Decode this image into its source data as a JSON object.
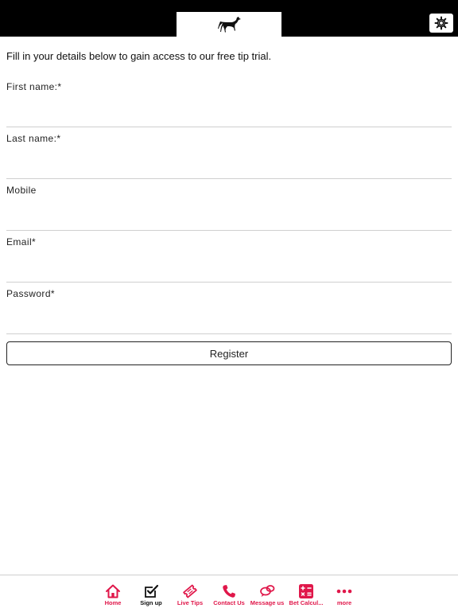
{
  "header": {
    "logo_icon": "greyhound-logo-icon",
    "settings_icon": "gear-icon"
  },
  "form": {
    "intro": "Fill in your details below to gain access to our free tip trial.",
    "fields": [
      {
        "label": "First name:*",
        "value": "",
        "placeholder": ""
      },
      {
        "label": "Last name:*",
        "value": "",
        "placeholder": ""
      },
      {
        "label": "Mobile",
        "value": "",
        "placeholder": ""
      },
      {
        "label": "Email*",
        "value": "",
        "placeholder": ""
      },
      {
        "label": "Password*",
        "value": "",
        "placeholder": ""
      }
    ],
    "register_label": "Register"
  },
  "tabbar": {
    "accent_color": "#e0174a",
    "items": [
      {
        "label": "Home",
        "icon": "home-icon"
      },
      {
        "label": "Sign up",
        "icon": "checkbox-icon"
      },
      {
        "label": "Live Tips",
        "icon": "ticket-icon"
      },
      {
        "label": "Contact Us",
        "icon": "phone-icon"
      },
      {
        "label": "Message us",
        "icon": "chat-icon"
      },
      {
        "label": "Bet Calcul...",
        "icon": "calculator-icon"
      },
      {
        "label": "more",
        "icon": "more-icon"
      }
    ]
  }
}
